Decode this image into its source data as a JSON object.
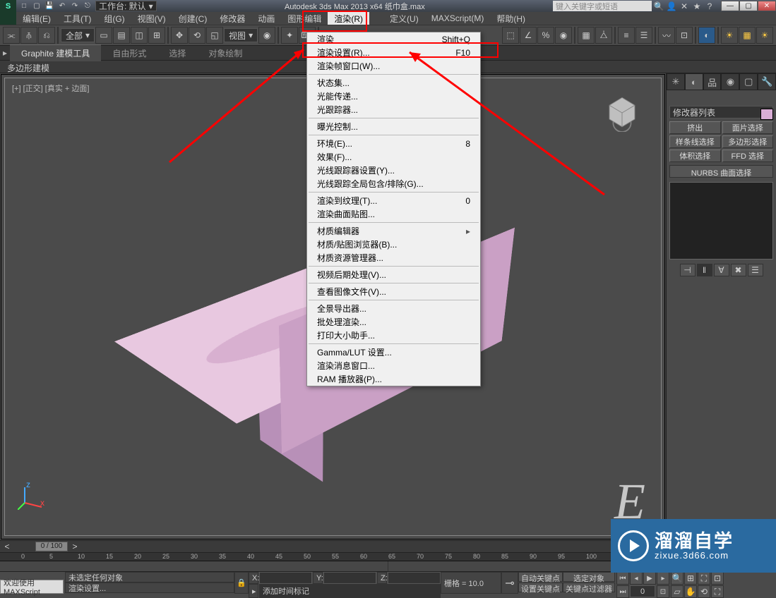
{
  "titlebar": {
    "workspace_label": "工作台: 默认",
    "app_title": "Autodesk 3ds Max 2013 x64   纸巾盒.max",
    "search_placeholder": "键入关键字或短语",
    "logo": "S"
  },
  "menubar": {
    "items": [
      "编辑(E)",
      "工具(T)",
      "组(G)",
      "视图(V)",
      "创建(C)",
      "修改器",
      "动画",
      "图形编辑",
      "渲染(R)",
      "",
      "定义(U)",
      "MAXScript(M)",
      "帮助(H)"
    ]
  },
  "toolbar": {
    "selset": "全部",
    "viewlabel": "视图"
  },
  "ribbon": {
    "tabs": [
      "Graphite 建模工具",
      "自由形式",
      "选择",
      "对象绘制"
    ],
    "subtab": "多边形建模"
  },
  "viewport": {
    "label": "[+] [正交] [真实 + 边面]"
  },
  "cmdpanel": {
    "modifier_list": "修改器列表",
    "buttons": [
      "挤出",
      "面片选择",
      "样条线选择",
      "多边形选择",
      "体积选择",
      "FFD 选择"
    ],
    "nurbs": "NURBS 曲面选择"
  },
  "dropdown": {
    "groups": [
      [
        {
          "label": "渲染",
          "accel": "Shift+Q"
        },
        {
          "label": "渲染设置(R)...",
          "accel": "F10"
        },
        {
          "label": "渲染帧窗口(W)..."
        }
      ],
      [
        {
          "label": "状态集..."
        },
        {
          "label": "光能传递..."
        },
        {
          "label": "光跟踪器..."
        }
      ],
      [
        {
          "label": "曝光控制..."
        }
      ],
      [
        {
          "label": "环境(E)...",
          "accel": "8"
        },
        {
          "label": "效果(F)..."
        },
        {
          "label": "光线跟踪器设置(Y)..."
        },
        {
          "label": "光线跟踪全局包含/排除(G)..."
        }
      ],
      [
        {
          "label": "渲染到纹理(T)...",
          "accel": "0"
        },
        {
          "label": "渲染曲面贴图..."
        }
      ],
      [
        {
          "label": "材质编辑器",
          "arrow": true
        },
        {
          "label": "材质/贴图浏览器(B)..."
        },
        {
          "label": "材质资源管理器..."
        }
      ],
      [
        {
          "label": "视频后期处理(V)..."
        }
      ],
      [
        {
          "label": "查看图像文件(V)..."
        }
      ],
      [
        {
          "label": "全景导出器..."
        },
        {
          "label": "批处理渲染..."
        },
        {
          "label": "打印大小助手..."
        }
      ],
      [
        {
          "label": "Gamma/LUT 设置..."
        },
        {
          "label": "渲染消息窗口..."
        },
        {
          "label": "RAM 播放器(P)..."
        }
      ]
    ]
  },
  "timeline": {
    "frame_display": "0 / 100",
    "ticks": [
      "0",
      "5",
      "10",
      "15",
      "20",
      "25",
      "30",
      "35",
      "40",
      "45",
      "50",
      "55",
      "60",
      "65",
      "70",
      "75",
      "80",
      "85",
      "90",
      "95",
      "100"
    ]
  },
  "status": {
    "welcome": "欢迎使用  MAXScript",
    "selection": "未选定任何对象",
    "hint": "渲染设置...",
    "x": "X:",
    "y": "Y:",
    "z": "Z:",
    "grid": "栅格 = 10.0",
    "addtime": "添加时间标记",
    "autokey": "自动关键点",
    "setkey": "设置关键点",
    "selobj": "选定对象",
    "keyfilter": "关键点过滤器"
  },
  "watermark": {
    "big": "溜溜自学",
    "small": "zixue.3d66.com"
  }
}
